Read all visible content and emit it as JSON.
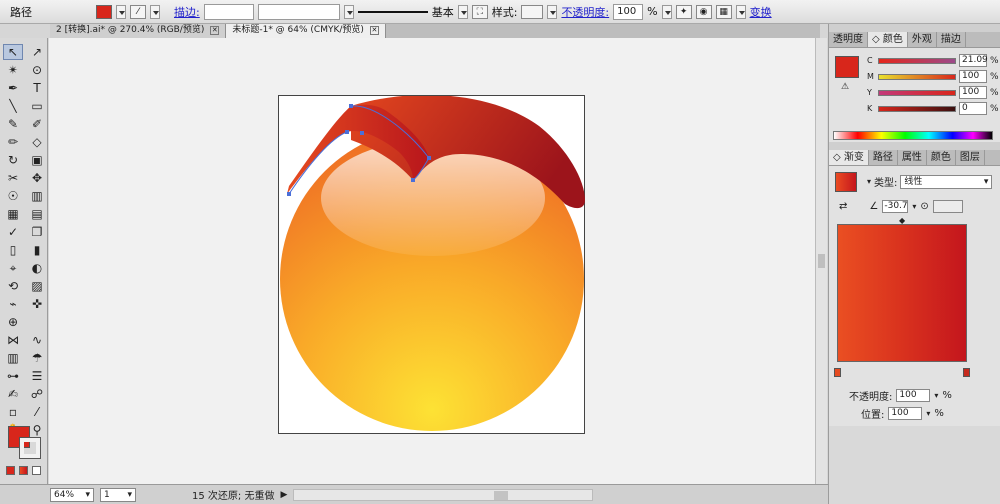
{
  "control_bar": {
    "selection_label": "路径",
    "stroke_link": "描边:",
    "stroke_weight": "",
    "brush_profile": "",
    "stroke_style": "基本",
    "style_label": "样式:",
    "opacity_link": "不透明度:",
    "opacity_value": "100",
    "opacity_unit": "%",
    "transform_link": "变换",
    "fill_color": "#d8261b"
  },
  "doc_tabs": [
    {
      "label": "2 [转换].ai* @ 270.4% (RGB/预览)",
      "close": "✕"
    },
    {
      "label": "未标题-1* @ 64% (CMYK/预览)",
      "close": "✕"
    }
  ],
  "tools": [
    "↖",
    "↗",
    "✴",
    "⊙",
    "✒",
    "T",
    "╲",
    "▭",
    "✎",
    "✐",
    "✏",
    "◇",
    "↻",
    "▣",
    "✂",
    "✥",
    "☉",
    "▥",
    "▦",
    "▤",
    "✓",
    "❐",
    "▯",
    "▮",
    "⌖",
    "◐",
    "⟲",
    "▨",
    "⌁",
    "✜",
    "⊕",
    "",
    "⋈",
    "∿",
    "▥",
    "☂",
    "⊶",
    "☰",
    "✍",
    "☍",
    "▫",
    "⁄",
    "✋",
    "⚲"
  ],
  "status_bar": {
    "zoom": "64%",
    "artboard": "1",
    "undo_text": "15 次还原; 无重做"
  },
  "color_panel": {
    "tabs": [
      "透明度",
      "◇ 颜色",
      "外观",
      "描边"
    ],
    "swatch_color": "#d8261b",
    "rows": [
      {
        "letter": "C",
        "value": "21.09",
        "unit": "%",
        "gradient": "linear-gradient(90deg,#e5261b,#9c4a8a)"
      },
      {
        "letter": "M",
        "value": "100",
        "unit": "%",
        "gradient": "linear-gradient(90deg,#e8e02e,#d8261b)"
      },
      {
        "letter": "Y",
        "value": "100",
        "unit": "%",
        "gradient": "linear-gradient(90deg,#c43a7a,#d8261b)"
      },
      {
        "letter": "K",
        "value": "0",
        "unit": "%",
        "gradient": "linear-gradient(90deg,#d8261b,#3a1010)"
      }
    ]
  },
  "gradient_panel": {
    "tabs": [
      "◇ 渐变",
      "路径",
      "属性",
      "颜色",
      "图层"
    ],
    "type_label": "类型:",
    "type_value": "线性",
    "angle_value": "-30.7",
    "opacity_label": "不透明度:",
    "opacity_value": "100",
    "position_label": "位置:",
    "position_value": "100",
    "unit": "%"
  }
}
